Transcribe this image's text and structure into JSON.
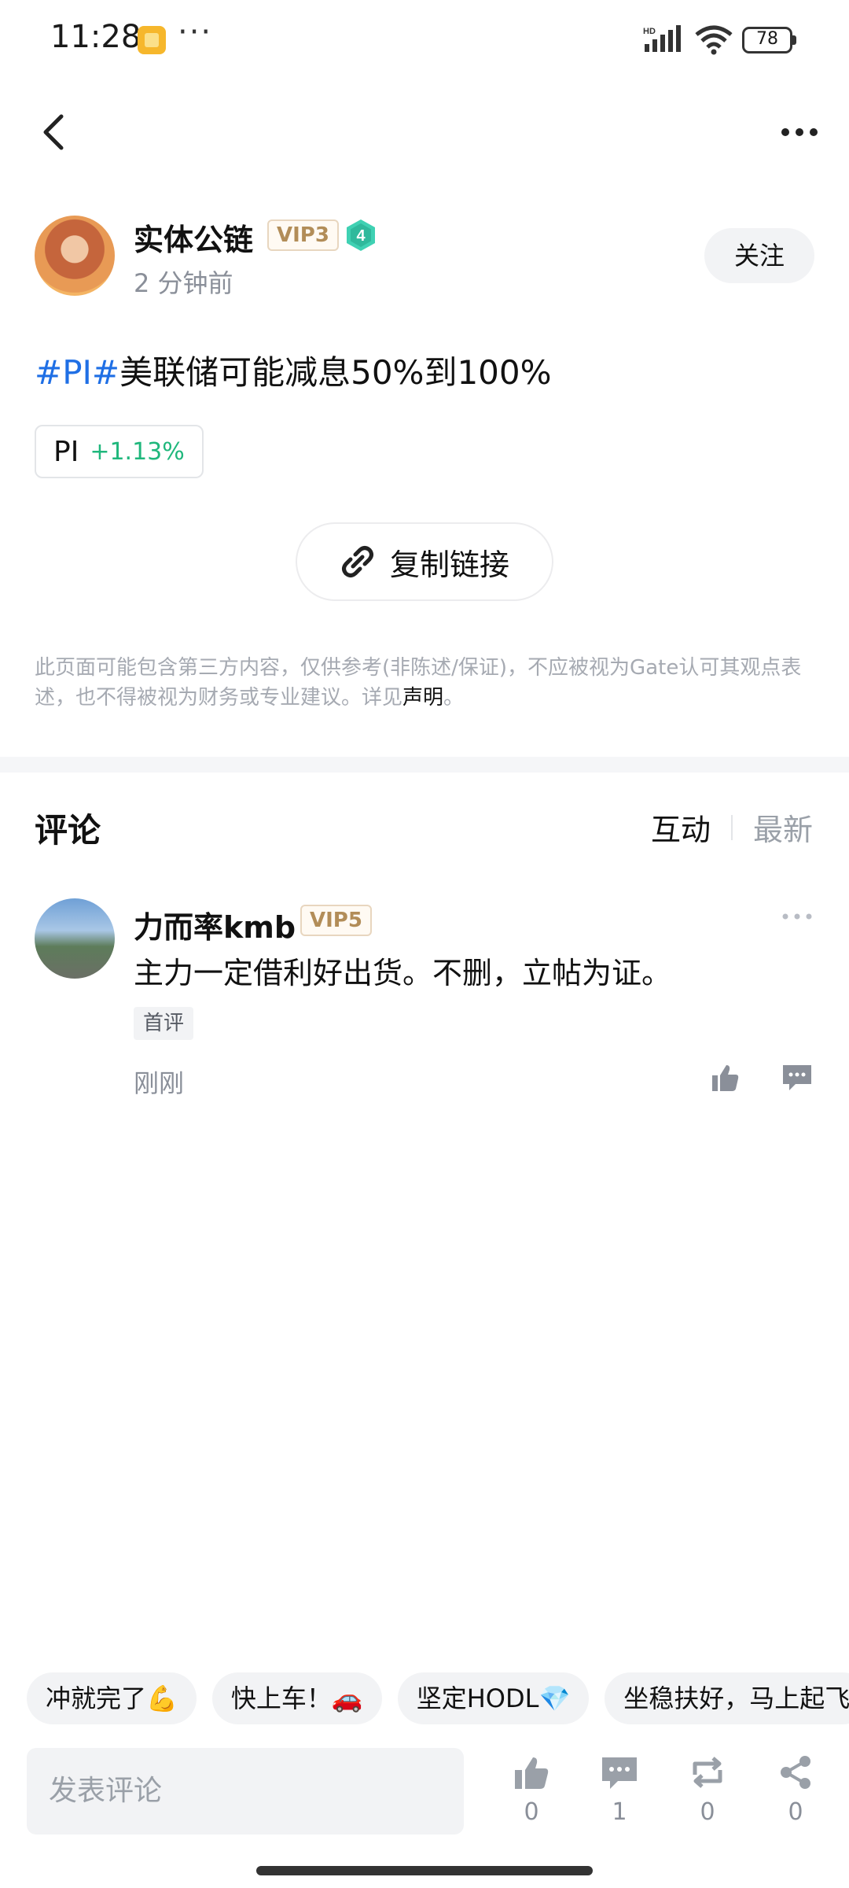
{
  "status_bar": {
    "time": "11:28",
    "dots": "···",
    "battery": "78",
    "hd_label": "HD"
  },
  "author": {
    "name": "实体公链",
    "vip": "VIP3",
    "level": "4",
    "time_ago": "2 分钟前",
    "follow_label": "关注"
  },
  "post": {
    "tag": "#PI#",
    "text": "美联储可能减息50%到100%",
    "coin": {
      "symbol": "PI",
      "change": "+1.13%"
    },
    "copy_link_label": "复制链接"
  },
  "disclaimer": {
    "text": "此页面可能包含第三方内容，仅供参考(非陈述/保证)，不应被视为Gate认可其观点表述，也不得被视为财务或专业建议。详见",
    "link": "声明",
    "end": "。"
  },
  "comments": {
    "title": "评论",
    "tabs": [
      {
        "label": "互动"
      },
      {
        "label": "最新"
      }
    ],
    "items": [
      {
        "name": "力而率kmb",
        "vip": "VIP5",
        "text": "主力一定借利好出货。不删，立帖为证。",
        "badge": "首评",
        "time": "刚刚"
      }
    ]
  },
  "quick_replies": [
    "冲就完了💪",
    "快上车！🚗",
    "坚定HODL💎",
    "坐稳扶好，马上起飞"
  ],
  "bottom_bar": {
    "input_placeholder": "发表评论",
    "actions": [
      {
        "icon": "thumbs-up-icon",
        "count": "0"
      },
      {
        "icon": "comment-icon",
        "count": "1"
      },
      {
        "icon": "repost-icon",
        "count": "0"
      },
      {
        "icon": "share-icon",
        "count": "0"
      }
    ]
  },
  "colors": {
    "hashtag": "#1f6fe5",
    "positive": "#1fb77c",
    "vip_text": "#b28d58",
    "level_badge": "#3fd1b3"
  }
}
